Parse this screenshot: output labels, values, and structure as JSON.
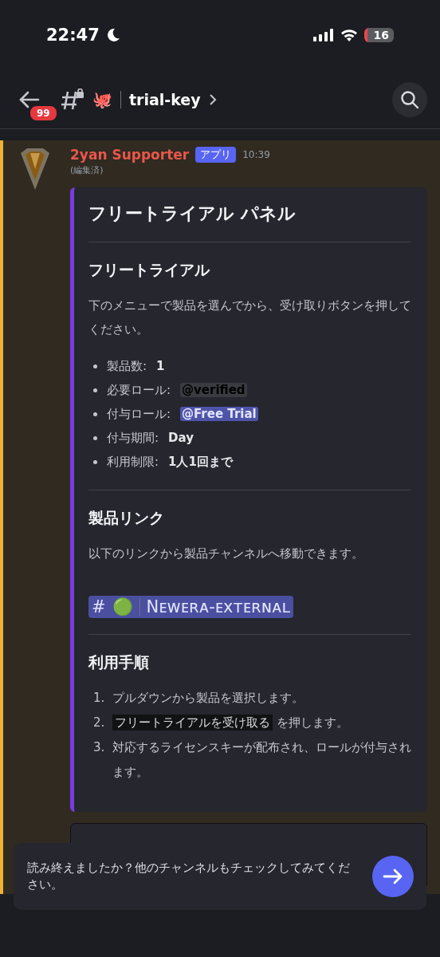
{
  "status_bar": {
    "time": "22:47",
    "battery": "16"
  },
  "header": {
    "unread_badge": "99",
    "channel_emoji": "🐙",
    "channel_name": "trial-key"
  },
  "message": {
    "author": "2yan Supporter",
    "tag": "アプリ",
    "time": "10:39",
    "edited": "(編集済)",
    "embed": {
      "title": "フリートライアル パネル",
      "sections": [
        {
          "heading": "フリートライアル",
          "blocks": [
            {
              "kind": "paragraph",
              "text": "下のメニューで製品を選んでから、受け取りボタンを押してください。"
            },
            {
              "kind": "bullets",
              "items": [
                {
                  "kind": "bold",
                  "label": "製品数:",
                  "value": "1"
                },
                {
                  "kind": "mention",
                  "label": "必要ロール:",
                  "value": "@verified",
                  "color": "#3a3b41"
                },
                {
                  "kind": "mention",
                  "label": "付与ロール:",
                  "value": "@Free Trial",
                  "color": "#4e55a8"
                },
                {
                  "kind": "bold",
                  "label": "付与期間:",
                  "value": "Day"
                },
                {
                  "kind": "bold",
                  "label": "利用制限:",
                  "value": "1人1回まで"
                }
              ]
            }
          ]
        },
        {
          "heading": "製品リンク",
          "blocks": [
            {
              "kind": "paragraph",
              "text": "以下のリンクから製品チャンネルへ移動できます。"
            },
            {
              "kind": "channel_link",
              "prefix": "#",
              "emoji": "🟢",
              "name": "Nᴇᴡᴇʀᴀ-ᴇxᴛᴇʀɴᴀʟ"
            }
          ]
        },
        {
          "heading": "利用手順",
          "blocks": [
            {
              "kind": "steps",
              "items": [
                {
                  "number": "1.",
                  "text": "プルダウンから製品を選択します。"
                },
                {
                  "number": "2.",
                  "highlight": "フリートライアルを受け取る",
                  "text": " を押します。"
                },
                {
                  "number": "3.",
                  "text": "対応するライセンスキーが配布され、ロールが付与されます。"
                }
              ]
            }
          ]
        }
      ]
    }
  },
  "toast": {
    "text": "読み終えましたか？他のチャンネルもチェックしてみてください。"
  }
}
